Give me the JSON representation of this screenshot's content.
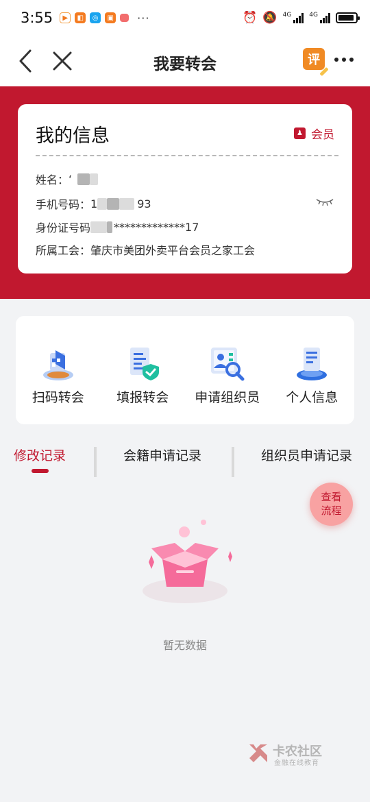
{
  "status_bar": {
    "time": "3:55",
    "more_glyph": "···",
    "signal1_label": "4G",
    "signal2_label": "4G",
    "battery_level": 0.9
  },
  "nav": {
    "title": "我要转会",
    "eval_label": "评"
  },
  "info": {
    "title": "我的信息",
    "member_label": "会员",
    "name_label": "姓名：",
    "name_value_start": "‘",
    "phone_label": "手机号码：",
    "phone_start": "1",
    "phone_end": "93",
    "id_label": "身份证号码",
    "id_end": "*************17",
    "union_label": "所属工会：",
    "union_value": "肇庆市美团外卖平台会员之家工会"
  },
  "actions": [
    {
      "label": "扫码转会",
      "icon": "scan-transfer-icon"
    },
    {
      "label": "填报转会",
      "icon": "form-transfer-icon"
    },
    {
      "label": "申请组织员",
      "icon": "apply-organizer-icon"
    },
    {
      "label": "个人信息",
      "icon": "personal-info-icon"
    }
  ],
  "tabs": [
    {
      "label": "修改记录",
      "active": true
    },
    {
      "label": "会籍申请记录",
      "active": false
    },
    {
      "label": "组织员申请记录",
      "active": false
    }
  ],
  "flow_button": {
    "line1": "查看",
    "line2": "流程"
  },
  "empty_text": "暂无数据",
  "watermark": {
    "name": "卡农社区",
    "subtitle": "金融在线教育"
  },
  "colors": {
    "primary": "#c1182f",
    "background": "#f2f3f5",
    "accent_orange": "#f08a24"
  }
}
